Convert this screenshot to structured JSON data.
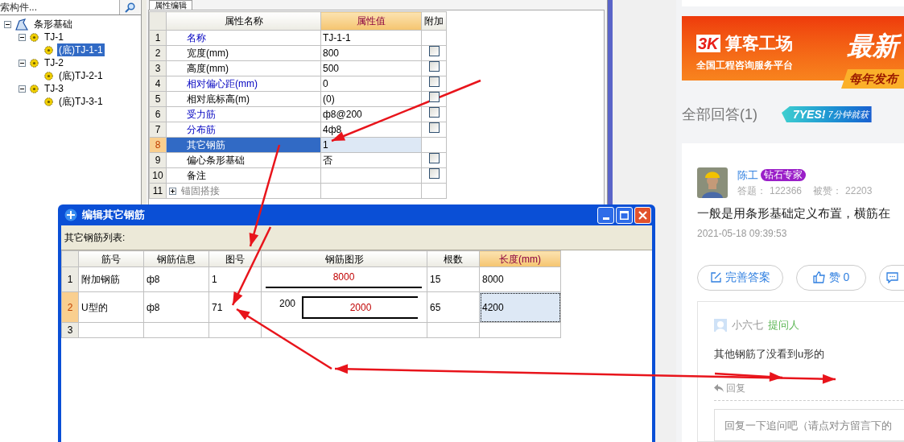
{
  "tree": {
    "search": {
      "placeholder": "索构件..."
    },
    "items": [
      {
        "label": "条形基础",
        "kind": "root",
        "expanded": true,
        "selected": false,
        "children": [
          {
            "label": "TJ-1",
            "kind": "component",
            "expanded": true,
            "selected": false,
            "children": [
              {
                "label": "(底)TJ-1-1",
                "kind": "component",
                "selected": true
              }
            ]
          },
          {
            "label": "TJ-2",
            "kind": "component",
            "expanded": true,
            "selected": false,
            "children": [
              {
                "label": "(底)TJ-2-1",
                "kind": "component",
                "selected": false
              }
            ]
          },
          {
            "label": "TJ-3",
            "kind": "component",
            "expanded": true,
            "selected": false,
            "children": [
              {
                "label": "(底)TJ-3-1",
                "kind": "component",
                "selected": false
              }
            ]
          }
        ]
      }
    ]
  },
  "property_panel": {
    "tab": "属性编辑",
    "columns": [
      {
        "label": "属性名称",
        "selected": false
      },
      {
        "label": "属性值",
        "selected": true
      },
      {
        "label": "附加",
        "selected": false
      }
    ],
    "rows": [
      {
        "no": "1",
        "name": "名称",
        "value": "TJ-1-1",
        "public": true,
        "selected": false
      },
      {
        "no": "2",
        "name": "宽度(mm)",
        "value": "800",
        "public": false,
        "selected": false,
        "checked": false
      },
      {
        "no": "3",
        "name": "高度(mm)",
        "value": "500",
        "public": false,
        "selected": false,
        "checked": false
      },
      {
        "no": "4",
        "name": "相对偏心距(mm)",
        "value": "0",
        "public": true,
        "selected": false,
        "checked": false
      },
      {
        "no": "5",
        "name": "相对底标高(m)",
        "value": "(0)",
        "public": false,
        "selected": false,
        "checked": false
      },
      {
        "no": "6",
        "name": "受力筋",
        "value": "ф8@200",
        "public": true,
        "selected": false,
        "checked": false
      },
      {
        "no": "7",
        "name": "分布筋",
        "value": "4ф8",
        "public": true,
        "selected": false,
        "checked": false
      },
      {
        "no": "8",
        "name": "其它钢筋",
        "value": "1",
        "public": false,
        "selected": true
      },
      {
        "no": "9",
        "name": "偏心条形基础",
        "value": "否",
        "public": false,
        "selected": false,
        "checked": false
      },
      {
        "no": "10",
        "name": "备注",
        "public": false,
        "selected": false,
        "checked": false
      },
      {
        "no": "11",
        "name": "锚固搭接",
        "kind": "group",
        "expanded": false,
        "selected": false
      }
    ]
  },
  "dialog": {
    "title": "编辑其它钢筋",
    "list_label": "其它钢筋列表:",
    "columns": [
      {
        "label": "筋号",
        "selected": false
      },
      {
        "label": "钢筋信息",
        "selected": false
      },
      {
        "label": "图号",
        "selected": false
      },
      {
        "label": "钢筋图形",
        "selected": false
      },
      {
        "label": "根数",
        "selected": false
      },
      {
        "label": "长度(mm)",
        "selected": true
      }
    ],
    "rows": [
      {
        "no": "1",
        "selected": false,
        "bar_no": "附加钢筋",
        "info": "ф8",
        "shape_no": "1",
        "shape": {
          "kind": "line",
          "length": "8000"
        },
        "count": "15",
        "length": "8000"
      },
      {
        "no": "2",
        "selected": true,
        "bar_no": "U型的",
        "info": "ф8",
        "shape_no": "71",
        "shape": {
          "kind": "u",
          "leg": "200",
          "length": "2000"
        },
        "count": "65",
        "length": "4200"
      },
      {
        "no": "3",
        "selected": false
      }
    ]
  },
  "web": {
    "banner": {
      "logo": "3K",
      "brand": "算客工场",
      "slogan": "全国工程咨询服务平台",
      "headline": "最新",
      "tagline": "每年发布"
    },
    "answers_heading": "全部回答(1)",
    "promo": {
      "badge": "7YES!",
      "text": "7分钟就获"
    },
    "answer": {
      "author": "陈工",
      "badge": "钻石专家",
      "stats": [
        {
          "label": "答题：",
          "value": "122366"
        },
        {
          "label": "被赞：",
          "value": "22203"
        }
      ],
      "text": "一般是用条形基础定义布置，横筋在",
      "time": "2021-05-18 09:39:53",
      "actions": [
        {
          "kind": "edit",
          "label": "完善答案"
        },
        {
          "kind": "like",
          "label": "赞 0"
        },
        {
          "kind": "comment"
        }
      ],
      "comment": {
        "author": "小六七",
        "role": "提问人",
        "text": "其他钢筋了没看到u形的",
        "reply": "回复"
      },
      "reply_field": {
        "placeholder": "回复一下追问吧（请点对方留言下的"
      }
    }
  }
}
